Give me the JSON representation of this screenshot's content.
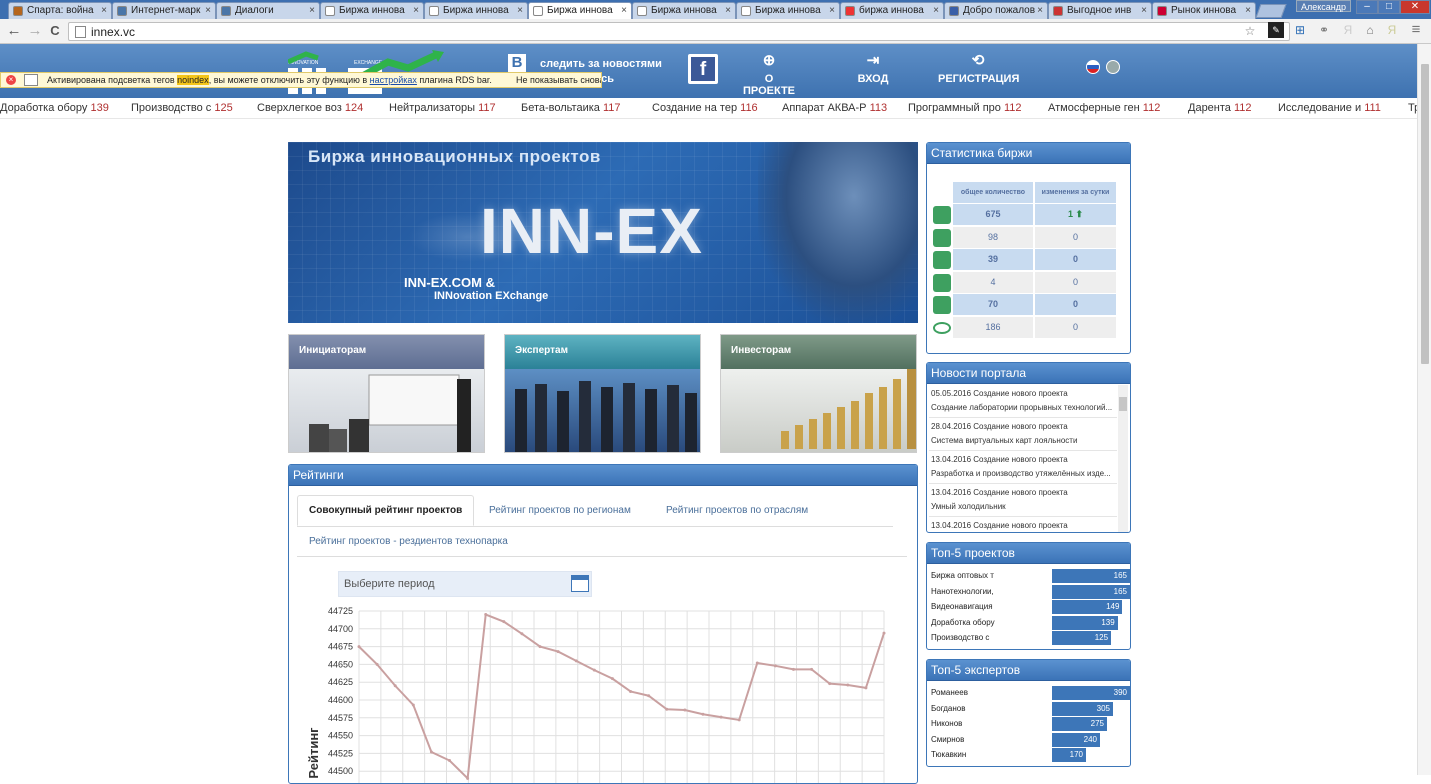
{
  "browser": {
    "tabs": [
      {
        "label": "Спарта: война",
        "color": "#b5651d"
      },
      {
        "label": "Интернет-марк",
        "color": "#4a76a8"
      },
      {
        "label": "Диалоги",
        "color": "#4a76a8"
      },
      {
        "label": "Биржа иннова",
        "color": "#ffffff"
      },
      {
        "label": "Биржа иннова",
        "color": "#ffffff"
      },
      {
        "label": "Биржа иннова",
        "color": "#ffffff",
        "active": true
      },
      {
        "label": "Биржа иннова",
        "color": "#ffffff"
      },
      {
        "label": "Биржа иннова",
        "color": "#ffffff"
      },
      {
        "label": "биржа иннова",
        "color": "#e33"
      },
      {
        "label": "Добро пожалов",
        "color": "#3a5fa8"
      },
      {
        "label": "Выгодное инв",
        "color": "#c33"
      },
      {
        "label": "Рынок иннова",
        "color": "#c03"
      }
    ],
    "user": "Александр",
    "win_min": "–",
    "win_max": "□",
    "win_close": "✕",
    "url": "innex.vc",
    "back_icon": "←",
    "forward_icon": "→",
    "reload_icon": "C",
    "star_icon": "☆",
    "menu_icon": "≡"
  },
  "header": {
    "follow_line1": "следить за новостями",
    "follow_line2": "удобно здесь",
    "menu": [
      {
        "label": "О ПРОЕКТЕ",
        "icon": "⊕"
      },
      {
        "label": "ВХОД",
        "icon": "⇥"
      },
      {
        "label": "РЕГИСТРАЦИЯ",
        "icon": "⟲"
      }
    ]
  },
  "rds": {
    "text_before": "Активирована подсветка тегов ",
    "highlight": "noindex",
    "text_mid": ", вы можете отключить эту функцию в ",
    "link": "настройках",
    "text_after": " плагина RDS bar.",
    "dismiss": "Не показывать снова"
  },
  "ticker": [
    {
      "name": "Доработка обору",
      "value": "139"
    },
    {
      "name": "Производство с",
      "value": "125"
    },
    {
      "name": "Сверхлегкое воз",
      "value": "124"
    },
    {
      "name": "Нейтрализаторы",
      "value": "117"
    },
    {
      "name": "Бета-вольтаика",
      "value": "117"
    },
    {
      "name": "Создание на тер",
      "value": "116"
    },
    {
      "name": "Аппарат АКВА-Р",
      "value": "113"
    },
    {
      "name": "Программный про",
      "value": "112"
    },
    {
      "name": "Атмосферные ген",
      "value": "112"
    },
    {
      "name": "Дарента",
      "value": "112"
    },
    {
      "name": "Исследование и",
      "value": "111"
    },
    {
      "name": "Тр",
      "value": ""
    }
  ],
  "banner": {
    "title": "Биржа инновационных проектов",
    "big": "INN-EX",
    "sub1": "INN-EX.COM &",
    "sub2": "INNovation EXchange"
  },
  "cards": [
    {
      "label": "Инициаторам",
      "color": "#6d7f9e"
    },
    {
      "label": "Экспертам",
      "color": "#3d8fa3"
    },
    {
      "label": "Инвесторам",
      "color": "#5f7f6e"
    }
  ],
  "rating": {
    "title": "Рейтинги",
    "tabs": [
      "Совокупный рейтинг проектов",
      "Рейтинг проектов по регионам",
      "Рейтинг проектов по отраслям",
      "Рейтинг проектов - рездиентов технопарка"
    ],
    "period_placeholder": "Выберите период"
  },
  "chart_data": {
    "type": "line",
    "ylabel": "Рейтинг",
    "yticks": [
      44725,
      44700,
      44675,
      44650,
      44625,
      44600,
      44575,
      44550,
      44525,
      44500
    ],
    "ylim": [
      44500,
      44725
    ],
    "color": "#c9a0a0",
    "values": [
      44675,
      44650,
      44620,
      44593,
      44527,
      44515,
      44490,
      44720,
      44710,
      44693,
      44675,
      44668,
      44655,
      44642,
      44630,
      44612,
      44606,
      44587,
      44586,
      44580,
      44576,
      44572,
      44652,
      44648,
      44643,
      44643,
      44623,
      44621,
      44617,
      44694
    ]
  },
  "stats": {
    "title": "Статистика биржи",
    "col1": "общее количество",
    "col2": "изменения за сутки",
    "rows": [
      {
        "icon": "folder-icon",
        "total": "675",
        "delta": "1 ⬆"
      },
      {
        "icon": "initiator-icon",
        "total": "98",
        "delta": "0"
      },
      {
        "icon": "expert-icon",
        "total": "39",
        "delta": "0"
      },
      {
        "icon": "handshake-icon",
        "total": "4",
        "delta": "0"
      },
      {
        "icon": "thumbs-up-icon",
        "total": "70",
        "delta": "0"
      },
      {
        "icon": "eye-icon",
        "total": "186",
        "delta": "0"
      }
    ]
  },
  "news": {
    "title": "Новости портала",
    "items": [
      {
        "date": "05.05.2016 Создание нового проекта",
        "text": "Создание лаборатории прорывных технологий..."
      },
      {
        "date": "28.04.2016 Создание нового проекта",
        "text": "Система виртуальных карт лояльности"
      },
      {
        "date": "13.04.2016 Создание нового проекта",
        "text": "Разработка и производство утяжелённых изде..."
      },
      {
        "date": "13.04.2016 Создание нового проекта",
        "text": "Умный холодильник"
      },
      {
        "date": "13.04.2016 Создание нового проекта",
        "text": ""
      }
    ]
  },
  "top_projects": {
    "title": "Топ-5 проектов",
    "max": 165,
    "items": [
      {
        "name": "Биржа оптовых т",
        "value": 165
      },
      {
        "name": "Нанотехнологии,",
        "value": 165
      },
      {
        "name": "Видеонавигация",
        "value": 149
      },
      {
        "name": "Доработка обору",
        "value": 139
      },
      {
        "name": "Производство с",
        "value": 125
      }
    ]
  },
  "top_experts": {
    "title": "Топ-5 экспертов",
    "max": 390,
    "items": [
      {
        "name": "Романеев",
        "value": 390
      },
      {
        "name": "Богданов",
        "value": 305
      },
      {
        "name": "Никонов",
        "value": 275
      },
      {
        "name": "Смирнов",
        "value": 240
      },
      {
        "name": "Тюкавкин",
        "value": 170
      }
    ]
  }
}
